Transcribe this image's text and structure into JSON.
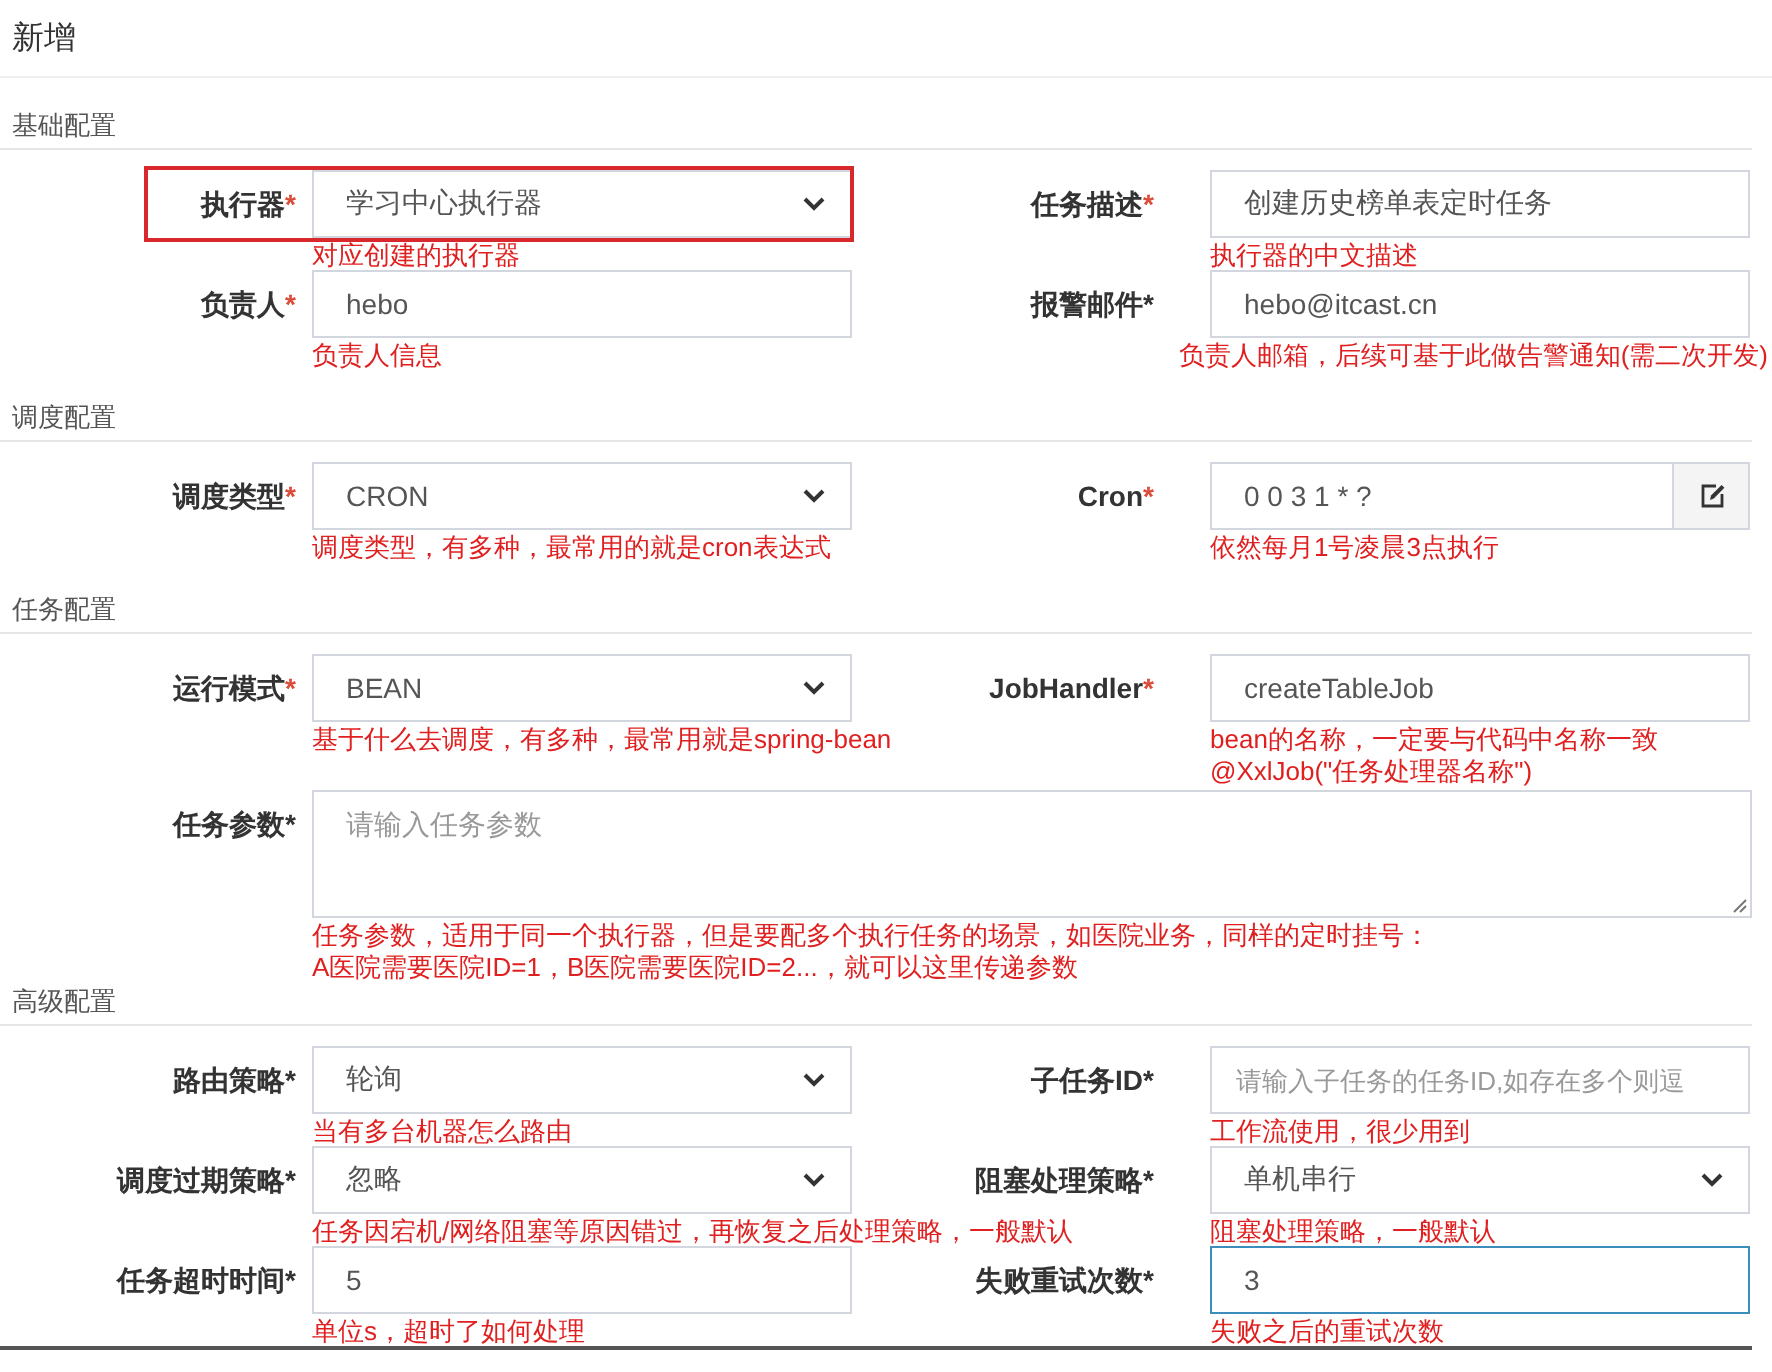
{
  "header": {
    "title": "新增"
  },
  "sections": [
    {
      "title": "基础配置",
      "rows": [
        {
          "fields": [
            {
              "label": "执行器",
              "star": "*",
              "star_red": true,
              "kind": "select",
              "value": "学习中心执行器",
              "note": "对应创建的执行器",
              "highlighted": true,
              "focused": false
            },
            {
              "label": "任务描述",
              "star": "*",
              "star_red": true,
              "kind": "input",
              "value": "创建历史榜单表定时任务",
              "note": "执行器的中文描述",
              "highlighted": false,
              "focused": false
            }
          ]
        },
        {
          "fields": [
            {
              "label": "负责人",
              "star": "*",
              "star_red": true,
              "kind": "input",
              "value": "hebo",
              "note": "负责人信息",
              "highlighted": false,
              "focused": false
            },
            {
              "label": "报警邮件",
              "star": "*",
              "star_red": false,
              "kind": "input",
              "value": "hebo@itcast.cn",
              "note": "负责人邮箱，后续可基于此做告警通知(需二次开发)",
              "highlighted": false,
              "focused": false
            }
          ]
        }
      ]
    },
    {
      "title": "调度配置",
      "rows": [
        {
          "fields": [
            {
              "label": "调度类型",
              "star": "*",
              "star_red": true,
              "kind": "select",
              "value": "CRON",
              "note": "调度类型，有多种，最常用的就是cron表达式",
              "highlighted": false,
              "focused": false
            },
            {
              "label": "Cron",
              "star": "*",
              "star_red": true,
              "kind": "input-button",
              "value": "0 0 3 1 * ?",
              "note": "依然每月1号凌晨3点执行",
              "highlighted": false,
              "focused": false
            }
          ]
        }
      ]
    },
    {
      "title": "任务配置",
      "rows": [
        {
          "fields": [
            {
              "label": "运行模式",
              "star": "*",
              "star_red": true,
              "kind": "select",
              "value": "BEAN",
              "note": "基于什么去调度，有多种，最常用就是spring-bean",
              "highlighted": false,
              "focused": false
            },
            {
              "label": "JobHandler",
              "star": "*",
              "star_red": true,
              "kind": "input",
              "value": "createTableJob",
              "note": "bean的名称，一定要与代码中名称一致\n@XxlJob(\"任务处理器名称\")",
              "highlighted": false,
              "focused": false
            }
          ]
        },
        {
          "fields": [
            {
              "label": "任务参数",
              "star": "*",
              "star_red": false,
              "kind": "textarea",
              "placeholder": "请输入任务参数",
              "note": "任务参数，适用于同一个执行器，但是要配多个执行任务的场景，如医院业务，同样的定时挂号：\nA医院需要医院ID=1，B医院需要医院ID=2...，就可以这里传递参数",
              "highlighted": false,
              "focused": false
            }
          ]
        }
      ]
    },
    {
      "title": "高级配置",
      "rows": [
        {
          "fields": [
            {
              "label": "路由策略",
              "star": "*",
              "star_red": false,
              "kind": "select",
              "value": "轮询",
              "note": "当有多台机器怎么路由",
              "highlighted": false,
              "focused": false
            },
            {
              "label": "子任务ID",
              "star": "*",
              "star_red": false,
              "kind": "input",
              "placeholder": "请输入子任务的任务ID,如存在多个则逗",
              "note": "工作流使用，很少用到",
              "highlighted": false,
              "focused": false
            }
          ]
        },
        {
          "fields": [
            {
              "label": "调度过期策略",
              "star": "*",
              "star_red": false,
              "kind": "select",
              "value": "忽略",
              "note": "任务因宕机/网络阻塞等原因错过，再恢复之后处理策略，一般默认",
              "highlighted": false,
              "focused": false
            },
            {
              "label": "阻塞处理策略",
              "star": "*",
              "star_red": false,
              "kind": "select",
              "value": "单机串行",
              "note": "阻塞处理策略，一般默认",
              "highlighted": false,
              "focused": false
            }
          ]
        },
        {
          "fields": [
            {
              "label": "任务超时时间",
              "star": "*",
              "star_red": false,
              "kind": "input",
              "value": "5",
              "note": "单位s，超时了如何处理",
              "highlighted": false,
              "focused": false
            },
            {
              "label": "失败重试次数",
              "star": "*",
              "star_red": false,
              "kind": "input",
              "value": "3",
              "note": "失败之后的重试次数",
              "highlighted": false,
              "focused": true
            }
          ]
        }
      ]
    }
  ]
}
